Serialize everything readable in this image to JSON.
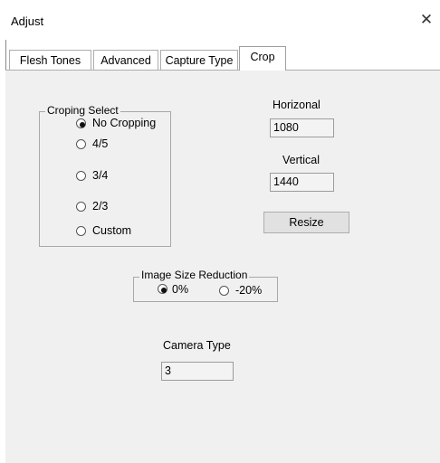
{
  "window": {
    "title": "Adjust",
    "close_glyph": "✕"
  },
  "tabs": [
    {
      "label": "Flesh Tones"
    },
    {
      "label": "Advanced"
    },
    {
      "label": "Capture Type"
    },
    {
      "label": "Crop"
    }
  ],
  "cropping_group": {
    "label": "Croping Select",
    "options": [
      {
        "label": "No Cropping",
        "checked": true
      },
      {
        "label": "4/5",
        "checked": false
      },
      {
        "label": "3/4",
        "checked": false
      },
      {
        "label": "2/3",
        "checked": false
      },
      {
        "label": "Custom",
        "checked": false
      }
    ]
  },
  "horizontal": {
    "label": "Horizonal",
    "value": "1080"
  },
  "vertical": {
    "label": "Vertical",
    "value": "1440"
  },
  "resize_button": {
    "label": "Resize"
  },
  "size_reduction_group": {
    "label": "Image Size Reduction",
    "options": [
      {
        "label": "0%",
        "checked": true
      },
      {
        "label": "-20%",
        "checked": false
      }
    ]
  },
  "camera_type": {
    "label": "Camera Type",
    "value": "3"
  }
}
